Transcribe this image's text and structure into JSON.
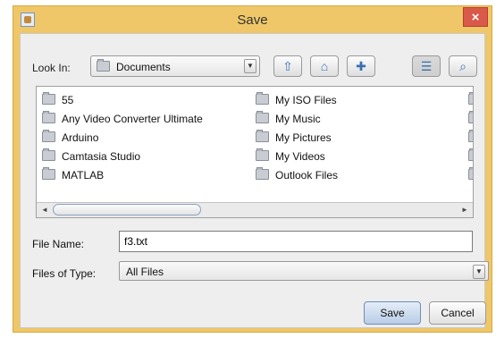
{
  "window": {
    "title": "Save",
    "close_glyph": "×",
    "app_icon": "java-app-icon"
  },
  "look_in": {
    "label": "Look In:",
    "value": "Documents",
    "arrow": "▼"
  },
  "toolbar": {
    "buttons": [
      {
        "name": "up-one-level",
        "icon": "folder-up-icon",
        "glyph": "⇧"
      },
      {
        "name": "home",
        "icon": "home-icon",
        "glyph": "⌂"
      },
      {
        "name": "create-new-folder",
        "icon": "new-folder-icon",
        "glyph": "✚"
      },
      {
        "name": "list-view",
        "icon": "list-view-icon",
        "glyph": "☰"
      },
      {
        "name": "details-view",
        "icon": "details-view-icon",
        "glyph": "⌕"
      }
    ]
  },
  "files": {
    "col1": [
      "55",
      "Any Video Converter Ultimate",
      "Arduino",
      "Camtasia Studio",
      "MATLAB"
    ],
    "col2": [
      "My ISO Files",
      "My Music",
      "My Pictures",
      "My Videos",
      "Outlook Files"
    ]
  },
  "scrollbar": {
    "left_arrow": "◄",
    "right_arrow": "►"
  },
  "file_name": {
    "label": "File Name:",
    "value": "f3.txt"
  },
  "file_type": {
    "label": "Files of Type:",
    "value": "All Files",
    "arrow": "▼"
  },
  "actions": {
    "save_label": "Save",
    "cancel_label": "Cancel"
  },
  "colors": {
    "titlebar": "#efc768",
    "close": "#d95a4a",
    "panel": "#eeeeee"
  }
}
